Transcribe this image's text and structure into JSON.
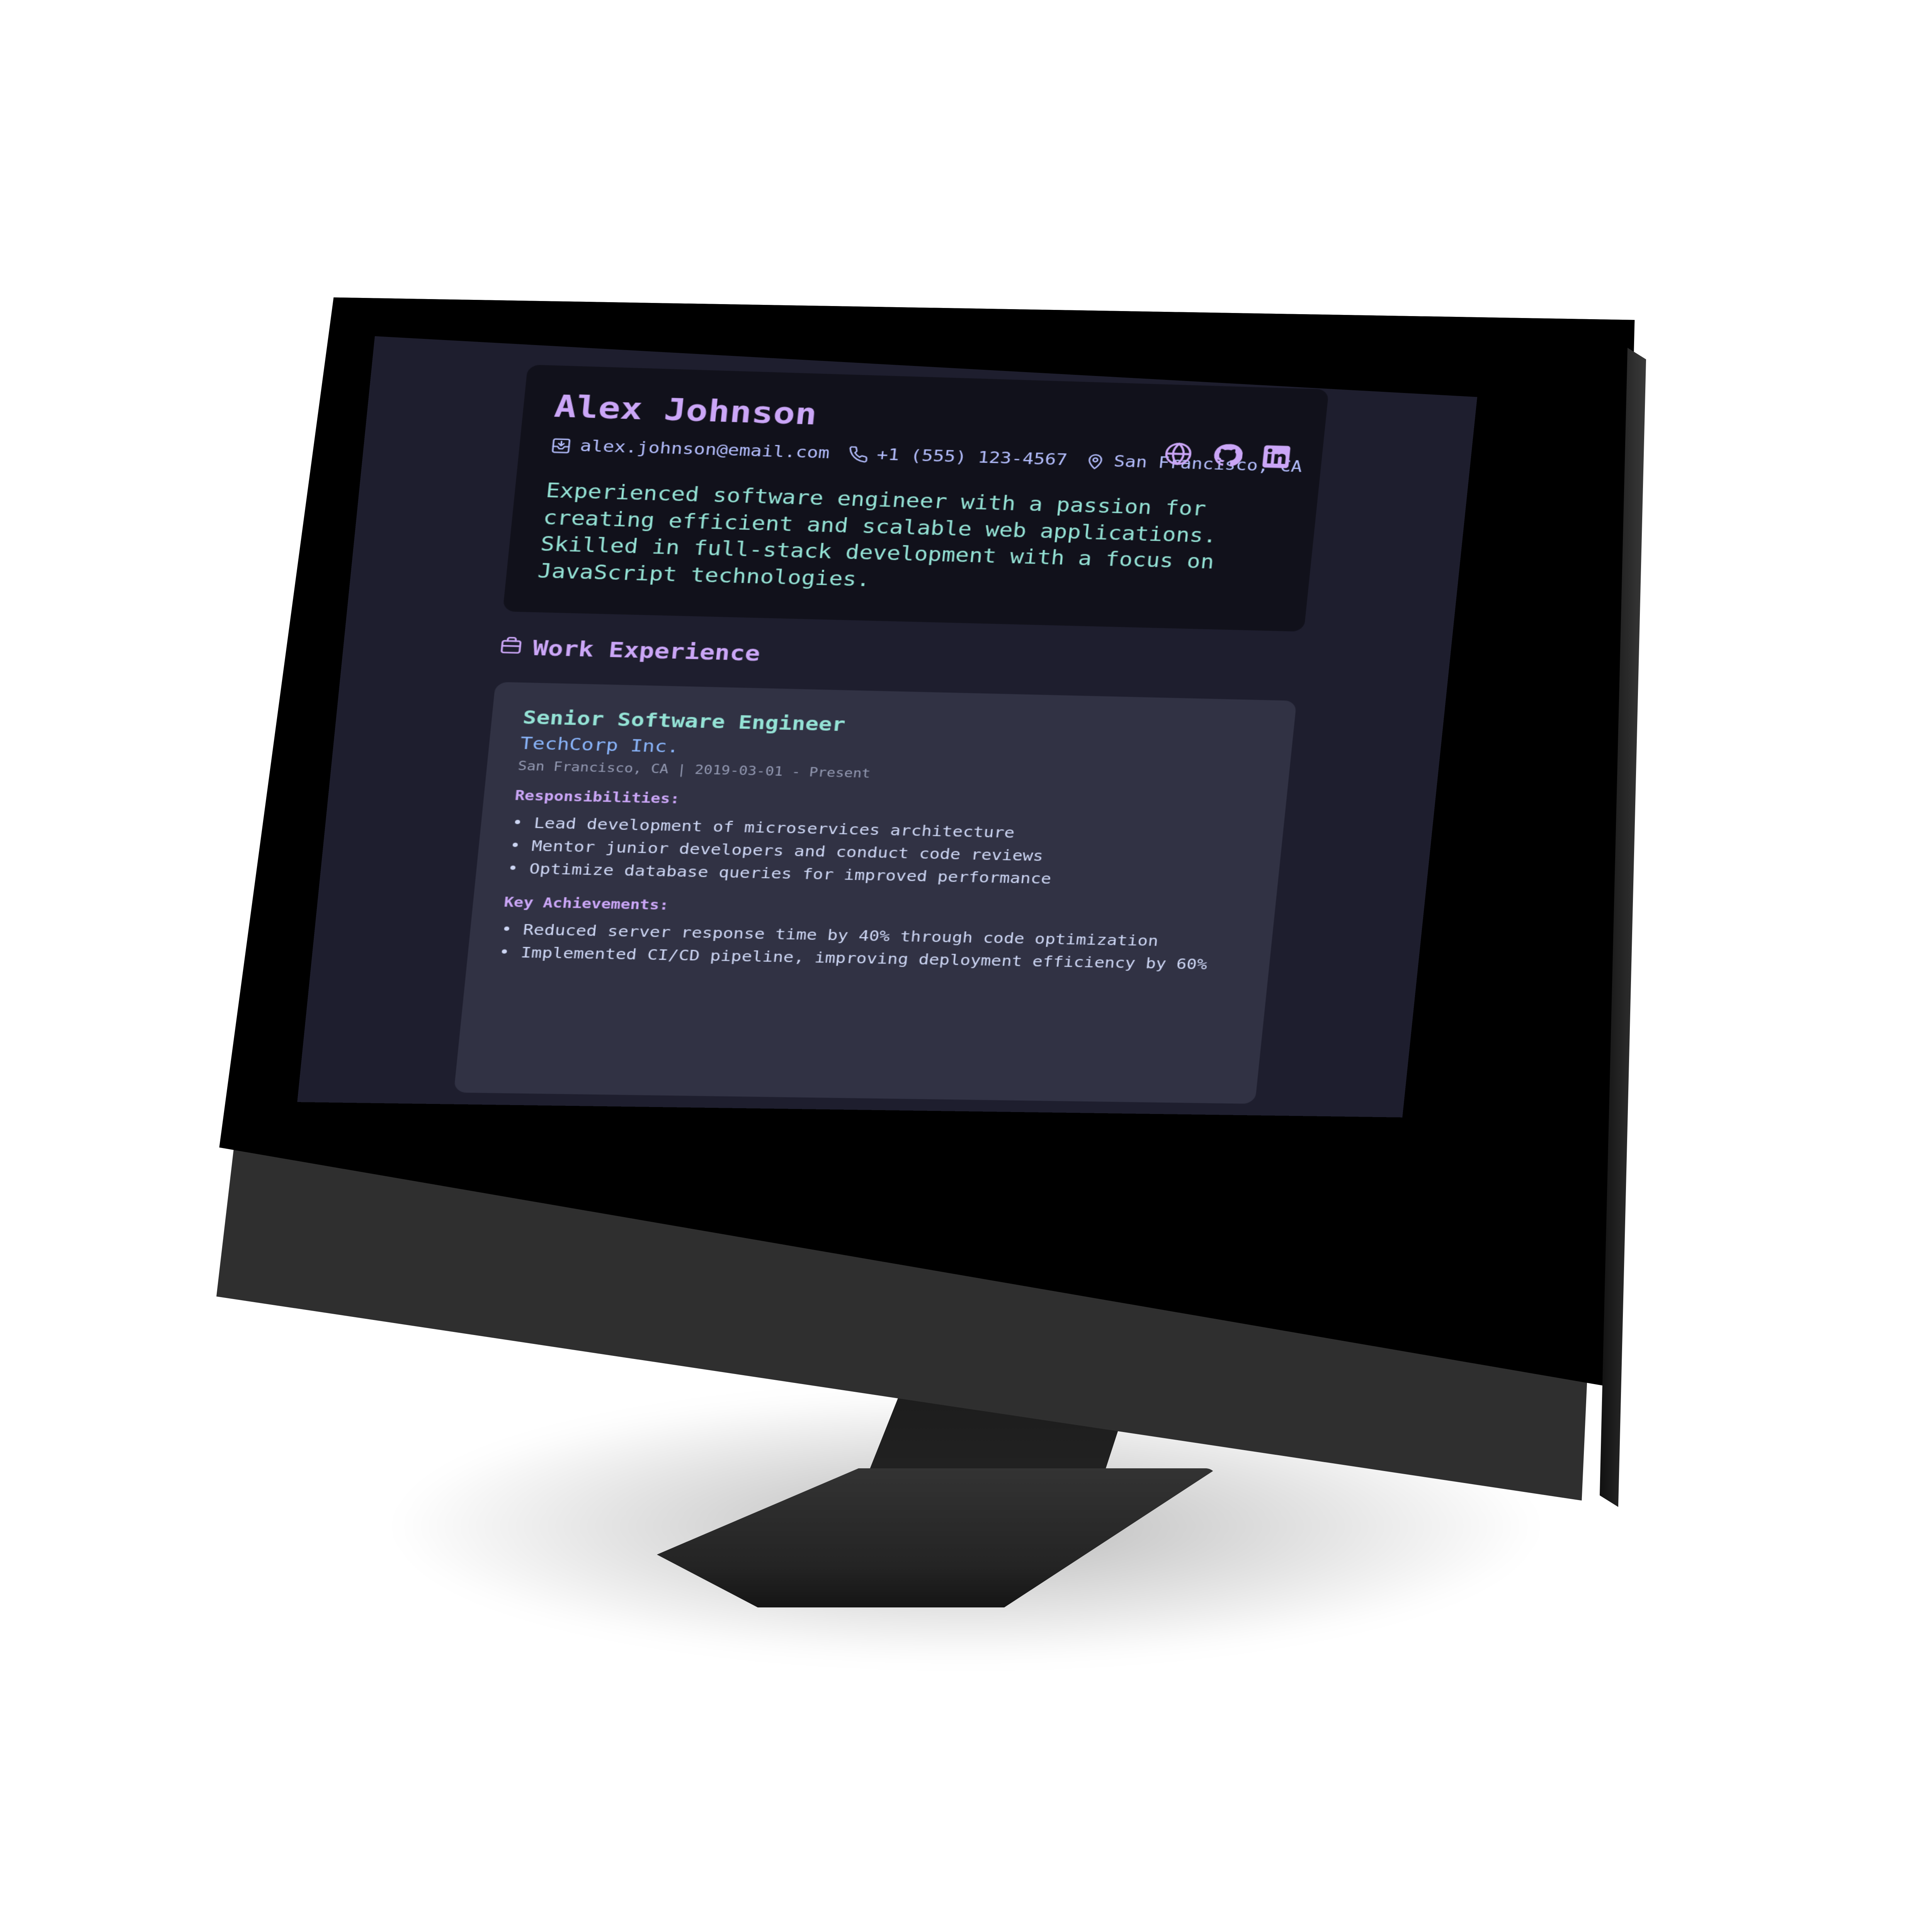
{
  "profile": {
    "name": "Alex Johnson",
    "email": "alex.johnson@email.com",
    "phone": "+1 (555) 123-4567",
    "location": "San Francisco, CA",
    "summary": "Experienced software engineer with a passion for creating efficient and scalable web applications. Skilled in full-stack development with a focus on JavaScript technologies."
  },
  "social": {
    "links": [
      {
        "icon": "globe-icon"
      },
      {
        "icon": "github-icon"
      },
      {
        "icon": "linkedin-icon"
      }
    ]
  },
  "work": {
    "section_title": "Work Experience",
    "jobs": [
      {
        "title": "Senior Software Engineer",
        "company": "TechCorp Inc.",
        "meta": "San Francisco, CA | 2019-03-01 - Present",
        "responsibilities_label": "Responsibilities:",
        "responsibilities": [
          "Lead development of microservices architecture",
          "Mentor junior developers and conduct code reviews",
          "Optimize database queries for improved performance"
        ],
        "achievements_label": "Key Achievements:",
        "achievements": [
          "Reduced server response time by 40% through code optimization",
          "Implemented CI/CD pipeline, improving deployment efficiency by 60%"
        ]
      }
    ]
  },
  "theme": {
    "background": "#1e1e2e",
    "card_dark": "#11111b",
    "card": "#313244",
    "accent_purple": "#cba6f7",
    "accent_teal": "#94e2d5",
    "accent_blue": "#89b4fa",
    "accent_lavender": "#b4befe"
  }
}
